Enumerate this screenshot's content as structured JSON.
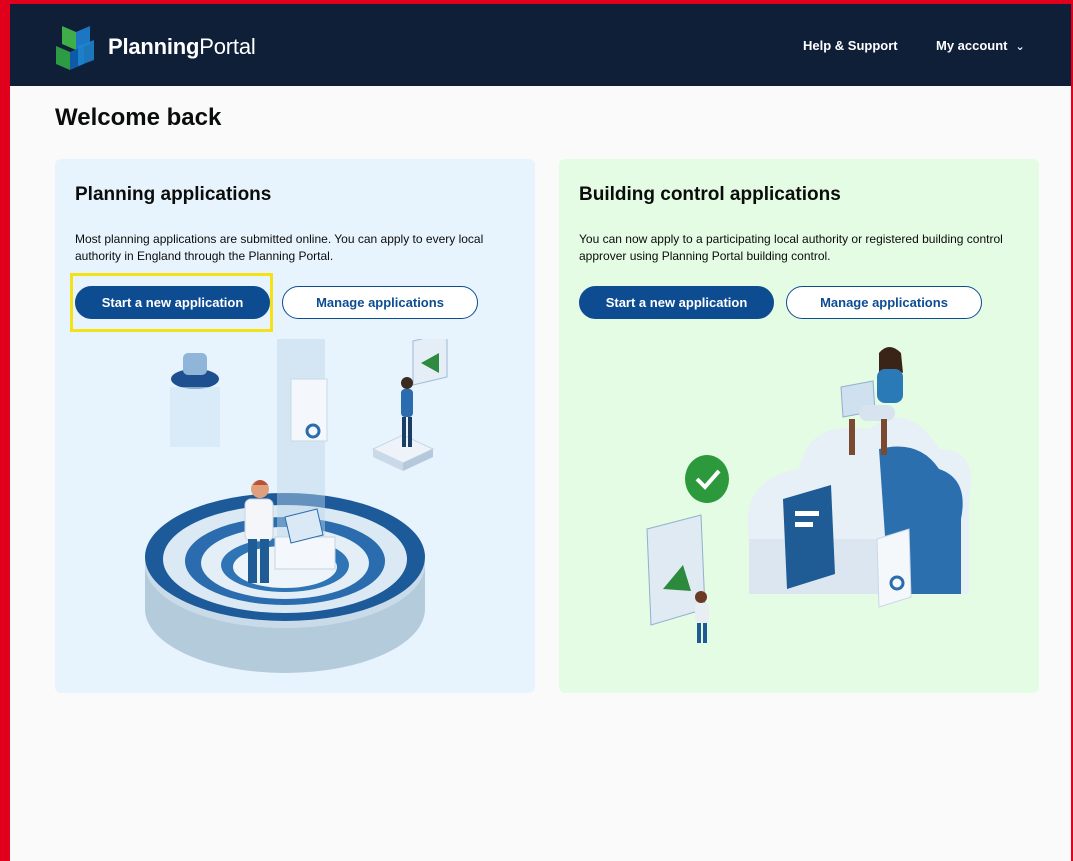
{
  "header": {
    "brand_bold": "Planning",
    "brand_light": "Portal",
    "help_label": "Help & Support",
    "account_label": "My account",
    "account_icon": "chevron-down-icon"
  },
  "page": {
    "title": "Welcome back"
  },
  "cards": [
    {
      "title": "Planning applications",
      "description": "Most planning applications are submitted online. You can apply to every local authority in England through the Planning Portal.",
      "primary_label": "Start a new application",
      "secondary_label": "Manage applications"
    },
    {
      "title": "Building control applications",
      "description": "You can now apply to a participating local authority or registered building control approver using Planning Portal building control.",
      "primary_label": "Start a new application",
      "secondary_label": "Manage applications"
    }
  ],
  "colors": {
    "navbar": "#0f1f38",
    "primary_button": "#0e4c92",
    "planning_card": "#e8f4fd",
    "building_card": "#e4fbe4",
    "highlight": "#f5e216",
    "frame": "#e0001b"
  }
}
